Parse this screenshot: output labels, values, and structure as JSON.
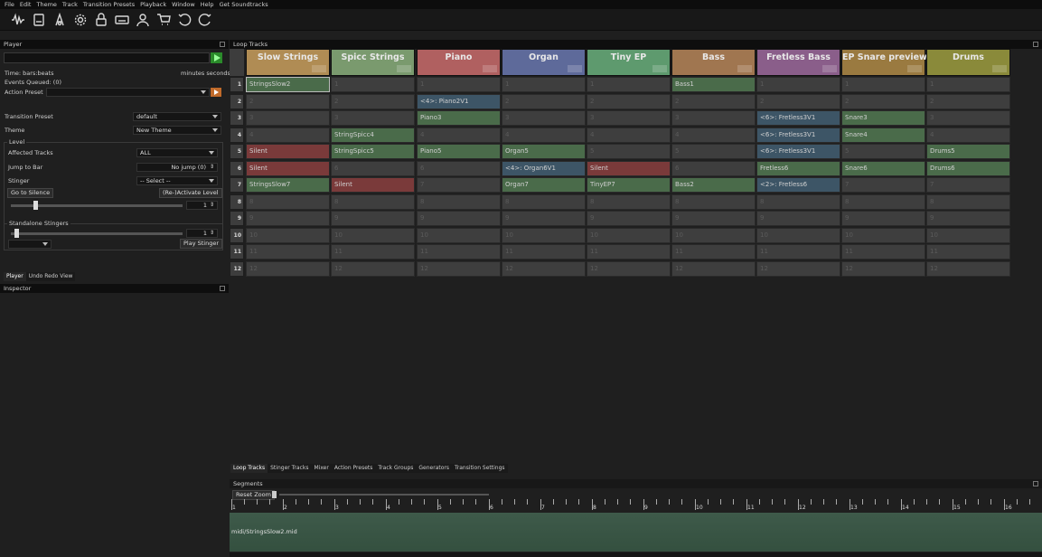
{
  "menu": [
    "File",
    "Edit",
    "Theme",
    "Track",
    "Transition Presets",
    "Playback",
    "Window",
    "Help",
    "Get Soundtracks"
  ],
  "toolbar": [
    "waveform-icon",
    "save-icon",
    "font-icon",
    "gear-icon",
    "lock-icon",
    "keyboard-icon",
    "user-icon",
    "cart-icon",
    "undo-icon",
    "redo-icon"
  ],
  "player": {
    "title": "Player",
    "time_label": "Time: bars:beats",
    "time_units": "minutes seconds",
    "events": "Events Queued: (0)",
    "action_preset_label": "Action Preset",
    "transition_preset_label": "Transition Preset",
    "transition_preset_value": "default",
    "theme_label": "Theme",
    "theme_value": "New Theme",
    "level_group": "Level",
    "affected_label": "Affected Tracks",
    "affected_value": "ALL",
    "jump_label": "Jump to Bar",
    "jump_value": "No jump (0)",
    "stinger_label": "Stinger",
    "stinger_value": "-- Select --",
    "go_silence": "Go to Silence",
    "reactivate": "(Re-)Activate Level",
    "level_spin": "1",
    "standalone_group": "Standalone Stingers",
    "standalone_spin": "1",
    "play_stinger": "Play Stinger",
    "level_slider": 0.13,
    "standalone_slider": 0.02
  },
  "left_tabs": [
    "Player",
    "Undo Redo View"
  ],
  "inspector": {
    "title": "Inspector"
  },
  "loop_tracks": {
    "title": "Loop Tracks",
    "columns": [
      {
        "name": "Slow Strings",
        "color": "#b08c54"
      },
      {
        "name": "Spicc Strings",
        "color": "#7a9a6e"
      },
      {
        "name": "Piano",
        "color": "#b06060"
      },
      {
        "name": "Organ",
        "color": "#5e6a9a"
      },
      {
        "name": "Tiny EP",
        "color": "#5e9a6e"
      },
      {
        "name": "Bass",
        "color": "#a07650"
      },
      {
        "name": "Fretless Bass",
        "color": "#8a5e8a"
      },
      {
        "name": "EP Snare preview",
        "color": "#9a7a40"
      },
      {
        "name": "Drums",
        "color": "#8a8a3a"
      }
    ],
    "row_numbers": [
      "1",
      "2",
      "3",
      "4",
      "5",
      "6",
      "7",
      "8",
      "9",
      "10",
      "11",
      "12"
    ],
    "cells": [
      [
        "StringsSlow2",
        "1",
        "1",
        "1",
        "1",
        "Bass1",
        "1",
        "1",
        "1"
      ],
      [
        "2",
        "2",
        "<4>: Piano2V1",
        "2",
        "2",
        "2",
        "2",
        "2",
        "2"
      ],
      [
        "3",
        "3",
        "Piano3",
        "3",
        "3",
        "3",
        "<6>: Fretless3V1",
        "Snare3",
        "3"
      ],
      [
        "4",
        "StringSpicc4",
        "4",
        "4",
        "4",
        "4",
        "<6>: Fretless3V1",
        "Snare4",
        "4"
      ],
      [
        "Silent",
        "StringSpicc5",
        "Piano5",
        "Organ5",
        "5",
        "5",
        "<6>: Fretless3V1",
        "5",
        "Drums5"
      ],
      [
        "Silent",
        "6",
        "6",
        "<4>: Organ6V1",
        "Silent",
        "6",
        "Fretless6",
        "Snare6",
        "Drums6"
      ],
      [
        "StringsSlow7",
        "Silent",
        "7",
        "Organ7",
        "TinyEP7",
        "Bass2",
        "<2>: Fretless6",
        "7",
        "7"
      ],
      [
        "8",
        "8",
        "8",
        "8",
        "8",
        "8",
        "8",
        "8",
        "8"
      ],
      [
        "9",
        "9",
        "9",
        "9",
        "9",
        "9",
        "9",
        "9",
        "9"
      ],
      [
        "10",
        "10",
        "10",
        "10",
        "10",
        "10",
        "10",
        "10",
        "10"
      ],
      [
        "11",
        "11",
        "11",
        "11",
        "11",
        "11",
        "11",
        "11",
        "11"
      ],
      [
        "12",
        "12",
        "12",
        "12",
        "12",
        "12",
        "12",
        "12",
        "12"
      ]
    ],
    "colors": {
      "green": "#4a6b4a",
      "red": "#7a3a3a",
      "blue": "#3d5566"
    }
  },
  "bottom_tabs": [
    "Loop Tracks",
    "Stinger Tracks",
    "Mixer",
    "Action Presets",
    "Track Groups",
    "Generators",
    "Transition Settings"
  ],
  "segments": {
    "title": "Segments",
    "reset_zoom": "Reset Zoom",
    "ruler": [
      "1",
      "2",
      "3",
      "4",
      "5",
      "6",
      "7",
      "8",
      "9",
      "10",
      "11",
      "12",
      "13",
      "14",
      "15",
      "16"
    ],
    "segment_label": "midi/StringsSlow2.mid"
  }
}
